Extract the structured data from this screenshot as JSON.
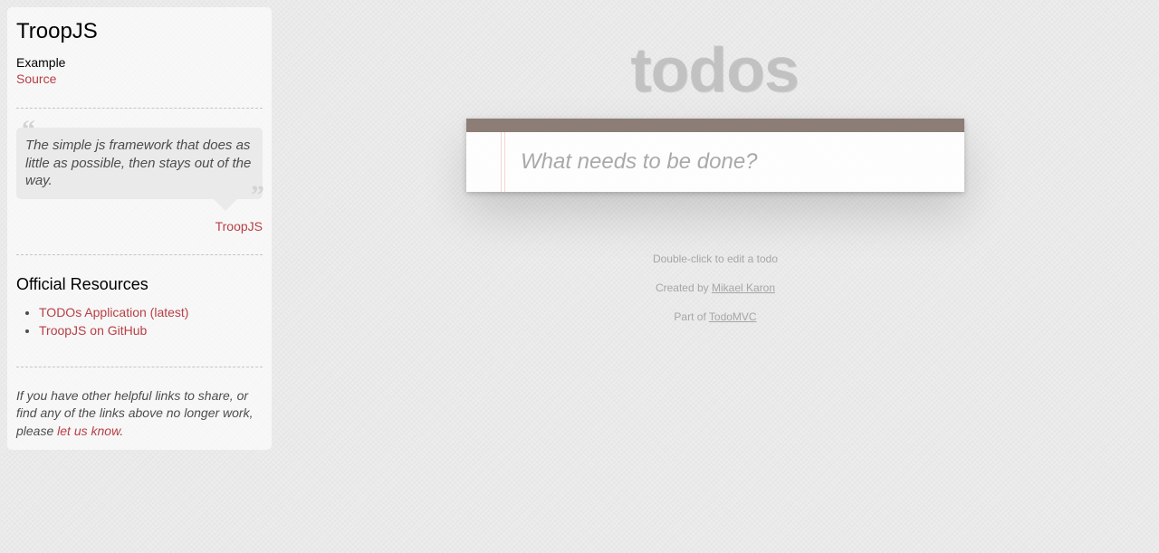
{
  "sidebar": {
    "title": "TroopJS",
    "example_label": "Example",
    "source_link": "Source",
    "quote": {
      "text": "The simple js framework that does as little as possible, then stays out of the way.",
      "author": "TroopJS"
    },
    "resources_title": "Official Resources",
    "resources": [
      {
        "label": "TODOs Application (latest)"
      },
      {
        "label": "TroopJS on GitHub"
      }
    ],
    "footnote_prefix": "If you have other helpful links to share, or find any of the links above no longer work, please ",
    "footnote_link": "let us know",
    "footnote_suffix": "."
  },
  "app": {
    "title": "todos",
    "new_todo_placeholder": "What needs to be done?",
    "new_todo_value": ""
  },
  "info": {
    "hint": "Double-click to edit a todo",
    "created_by_prefix": "Created by ",
    "created_by_name": "Mikael Karon",
    "part_of_prefix": "Part of ",
    "part_of_name": "TodoMVC"
  },
  "colors": {
    "accent_link": "#b83f45",
    "topbar": "#8d7d77",
    "background": "#eaeaea"
  }
}
